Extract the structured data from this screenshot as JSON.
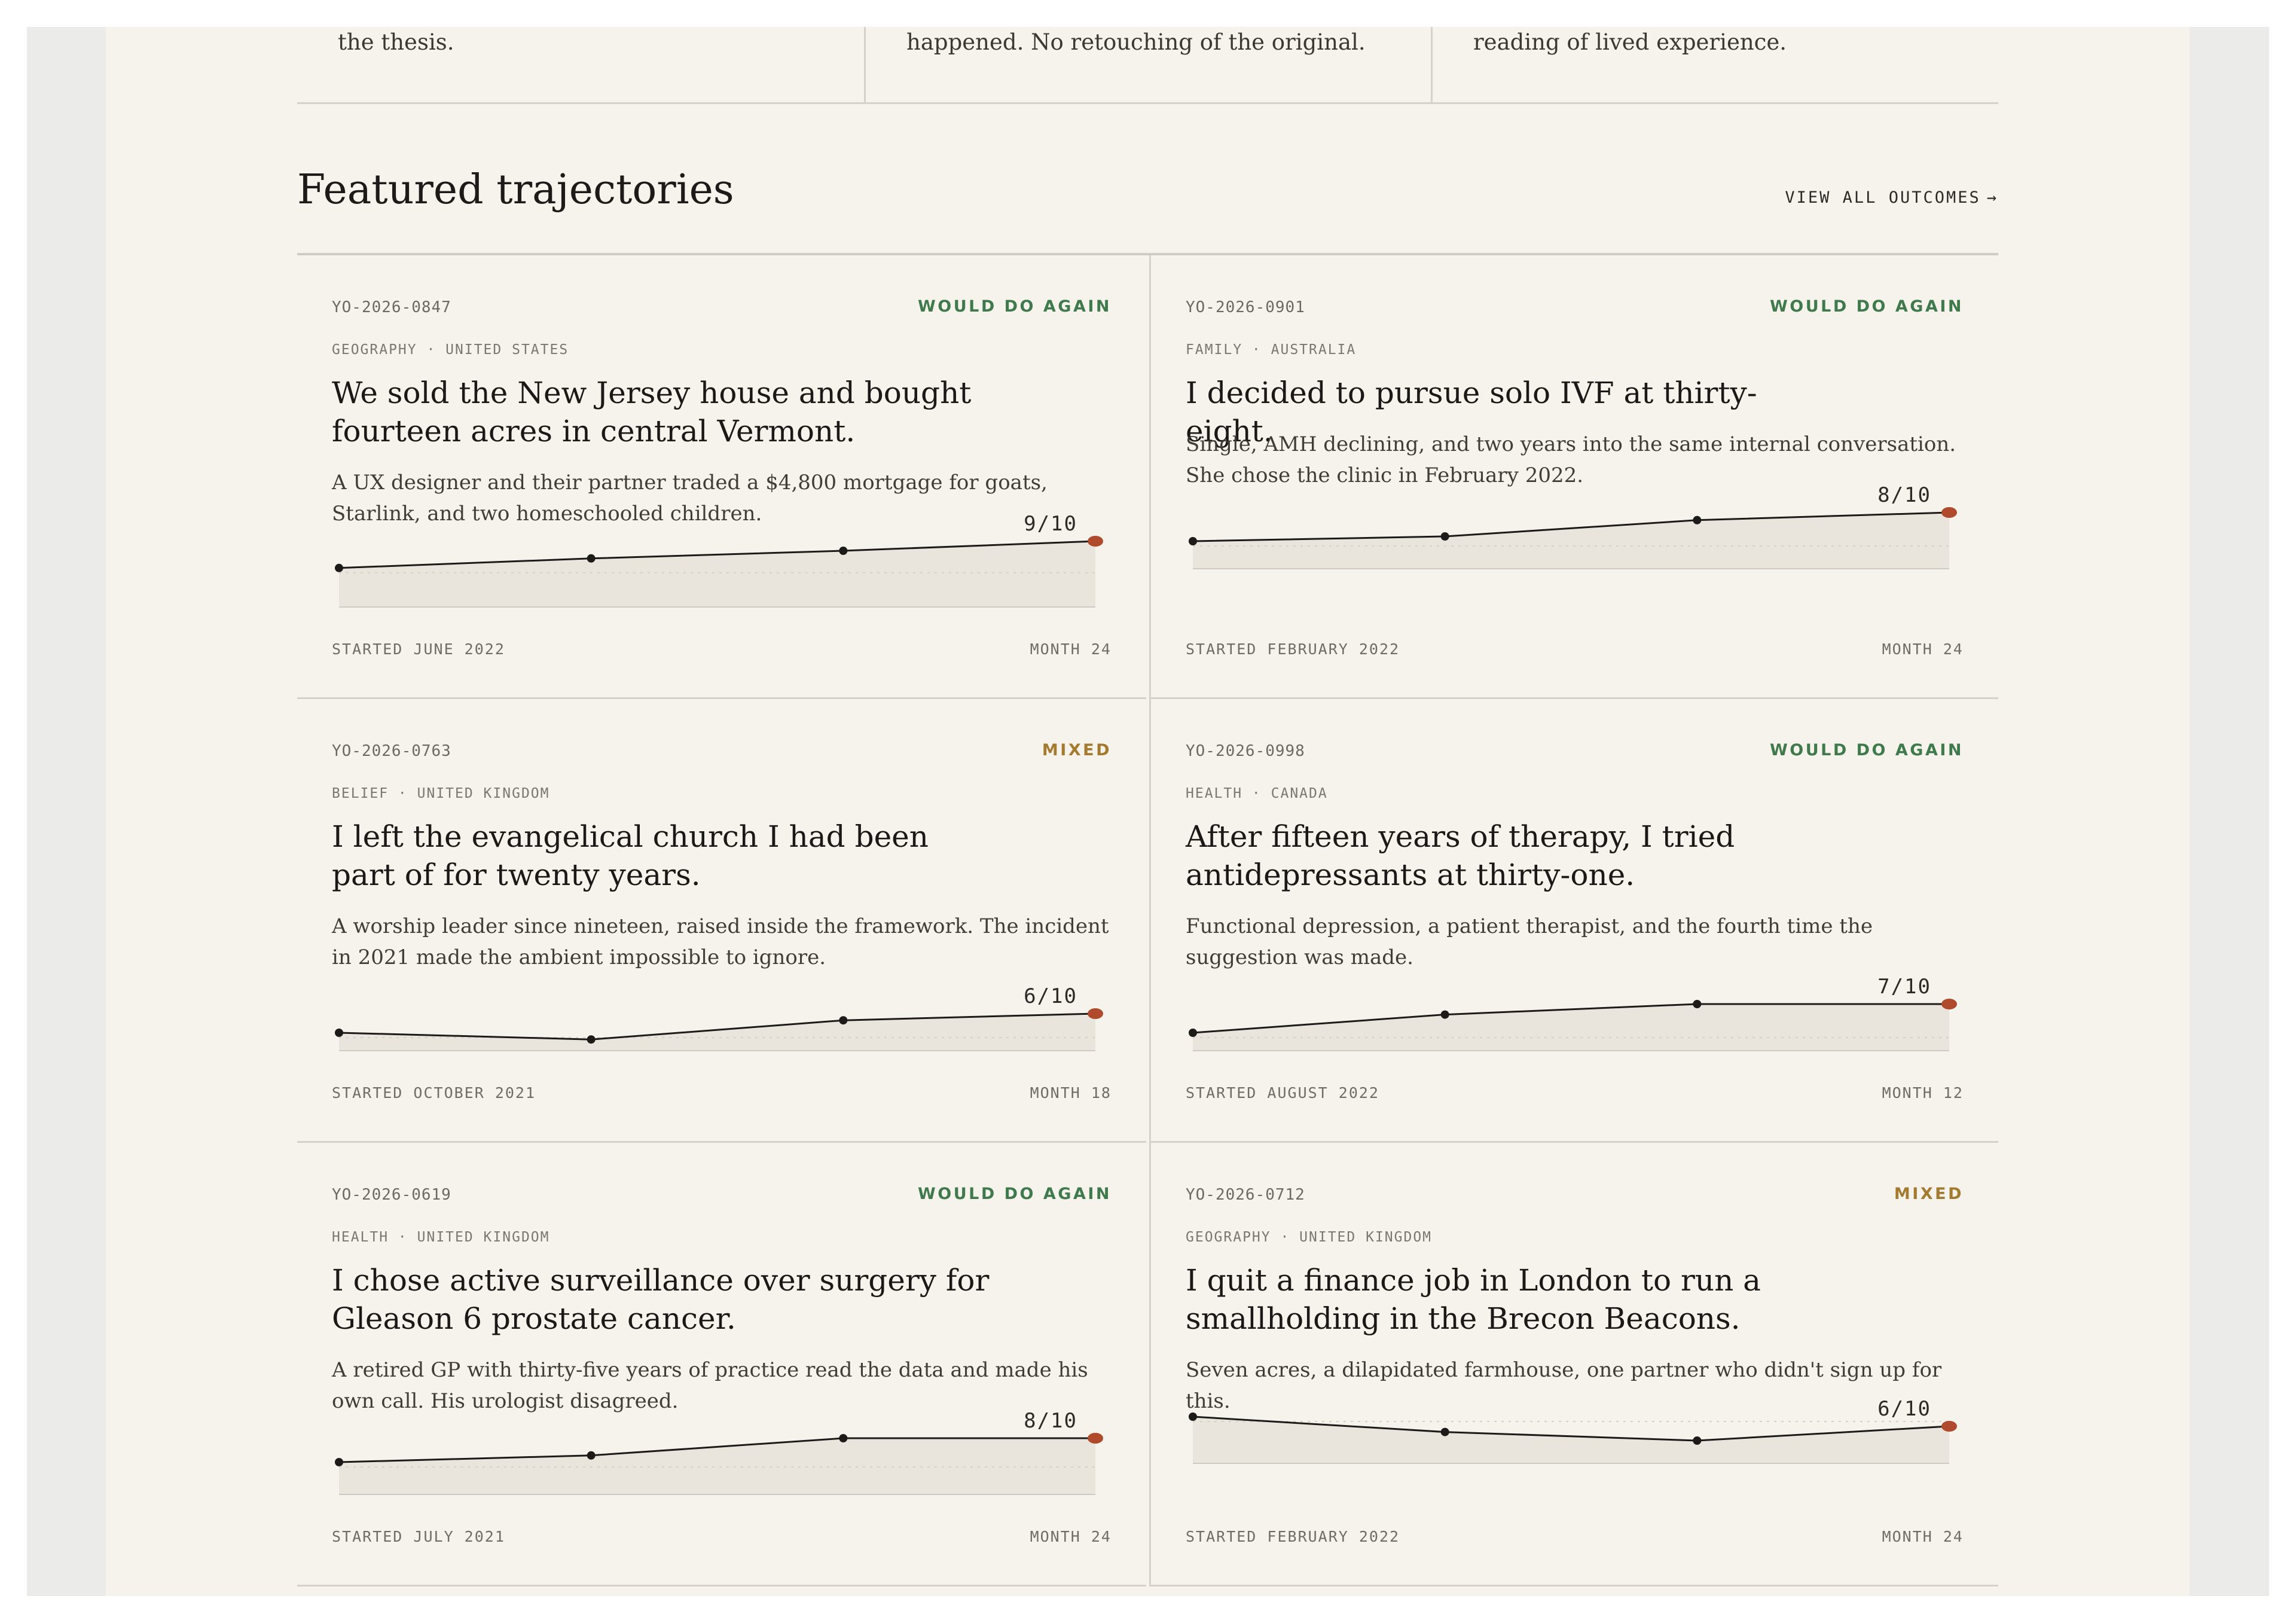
{
  "top_strip": [
    "the thesis.",
    "happened. No retouching of the original.",
    "reading of lived experience."
  ],
  "section": {
    "title": "Featured trajectories",
    "view_all": "VIEW ALL OUTCOMES",
    "view_all_arrow": "→"
  },
  "colors": {
    "page_bg": "#f6f3ec",
    "would_do_again": "#3f7a4c",
    "mixed": "#a37a2e",
    "line": "#1c1b19",
    "endpoint": "#b04a2c",
    "area": "#e9e4dc"
  },
  "cards": [
    {
      "id": "YO-2026-0847",
      "verdict": "WOULD DO AGAIN",
      "verdict_kind": "would_do_again",
      "meta": "GEOGRAPHY · UNITED STATES",
      "title": "We sold the New Jersey house and bought fourteen acres in central Vermont.",
      "description": "A UX designer and their partner traded a $4,800 mortgage for goats, Starlink, and two homeschooled children.",
      "score_label": "9/10",
      "scores": [
        6.2,
        7.2,
        8.0,
        9
      ],
      "started": "STARTED JUNE 2022",
      "month": "MONTH 24"
    },
    {
      "id": "YO-2026-0901",
      "verdict": "WOULD DO AGAIN",
      "verdict_kind": "would_do_again",
      "meta": "FAMILY · AUSTRALIA",
      "title": "I decided to pursue solo IVF at thirty-eight.",
      "description": "Single, AMH declining, and two years into the same internal conversation. She chose the clinic in February 2022.",
      "score_label": "8/10",
      "scores": [
        5.0,
        5.5,
        7.2,
        8
      ],
      "started": "STARTED FEBRUARY 2022",
      "month": "MONTH 24"
    },
    {
      "id": "YO-2026-0763",
      "verdict": "MIXED",
      "verdict_kind": "mixed",
      "meta": "BELIEF · UNITED KINGDOM",
      "title": "I left the evangelical church I had been part of for twenty years.",
      "description": "A worship leader since nineteen, raised inside the framework. The incident in 2021 made the ambient impossible to ignore.",
      "score_label": "6/10",
      "scores": [
        4.0,
        3.3,
        5.3,
        6
      ],
      "started": "STARTED OCTOBER 2021",
      "month": "MONTH 18"
    },
    {
      "id": "YO-2026-0998",
      "verdict": "WOULD DO AGAIN",
      "verdict_kind": "would_do_again",
      "meta": "HEALTH · CANADA",
      "title": "After fifteen years of therapy, I tried antidepressants at thirty-one.",
      "description": "Functional depression, a patient therapist, and the fourth time the suggestion was made.",
      "score_label": "7/10",
      "scores": [
        4.0,
        5.9,
        7.0,
        7
      ],
      "started": "STARTED AUGUST 2022",
      "month": "MONTH 12"
    },
    {
      "id": "YO-2026-0619",
      "verdict": "WOULD DO AGAIN",
      "verdict_kind": "would_do_again",
      "meta": "HEALTH · UNITED KINGDOM",
      "title": "I chose active surveillance over surgery for Gleason 6 prostate cancer.",
      "description": "A retired GP with thirty-five years of practice read the data and made his own call. His urologist disagreed.",
      "score_label": "8/10",
      "scores": [
        5.5,
        6.2,
        8.0,
        8
      ],
      "started": "STARTED JULY 2021",
      "month": "MONTH 24"
    },
    {
      "id": "YO-2026-0712",
      "verdict": "MIXED",
      "verdict_kind": "mixed",
      "meta": "GEOGRAPHY · UNITED KINGDOM",
      "title": "I quit a finance job in London to run a smallholding in the Brecon Beacons.",
      "description": "Seven acres, a dilapidated farmhouse, one partner who didn't sign up for this.",
      "score_label": "6/10",
      "scores": [
        7.0,
        5.4,
        4.5,
        6
      ],
      "started": "STARTED FEBRUARY 2022",
      "month": "MONTH 24"
    }
  ]
}
